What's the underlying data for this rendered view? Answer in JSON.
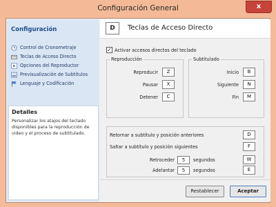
{
  "window": {
    "title": "Configuración General",
    "close_glyph": "x"
  },
  "sidebar": {
    "heading": "Configuración",
    "items": [
      {
        "label": "Control de Cronometraje",
        "icon": "clock-icon"
      },
      {
        "label": "Teclas de Acceso Directo",
        "icon": "keyboard-icon"
      },
      {
        "label": "Opciones del Reproductor",
        "icon": "player-icon"
      },
      {
        "label": "Previsualización de Subtítulos",
        "icon": "preview-icon"
      },
      {
        "label": "Lenguaje y Codificación",
        "icon": "flag-icon"
      }
    ]
  },
  "details": {
    "title": "Detalles",
    "text": "Personalizar los atajos del teclado disponibles para la reproducción de video y el proceso de subtitulado."
  },
  "page": {
    "icon_letter": "D",
    "title": "Teclas de Acceso Directo"
  },
  "enable_checkbox": {
    "checked_glyph": "✓",
    "label": "Activar accesos directos del teclado"
  },
  "playback_group": {
    "label": "Reproducción",
    "rows": [
      {
        "label": "Reproducir",
        "key": "Z"
      },
      {
        "label": "Pausar",
        "key": "X"
      },
      {
        "label": "Detener",
        "key": "C"
      }
    ]
  },
  "subtitle_group": {
    "label": "Subtitulado",
    "rows": [
      {
        "label": "Inicio",
        "key": "B"
      },
      {
        "label": "Siguiente",
        "key": "N"
      },
      {
        "label": "Fin",
        "key": "M"
      }
    ]
  },
  "navigation_group": {
    "back": {
      "label": "Retornar a subtítulo y posición anteriores",
      "key": "D"
    },
    "forward": {
      "label": "Saltar a subtítulo y posición siguientes",
      "key": "F"
    },
    "rewind": {
      "label": "Retroceder",
      "seconds": "5",
      "unit": "segundos",
      "key": "W"
    },
    "advance": {
      "label": "Adelantar",
      "seconds": "5",
      "unit": "segundos",
      "key": "E"
    }
  },
  "footer": {
    "reset_label": "Restablecer",
    "accept_label": "Aceptar"
  }
}
